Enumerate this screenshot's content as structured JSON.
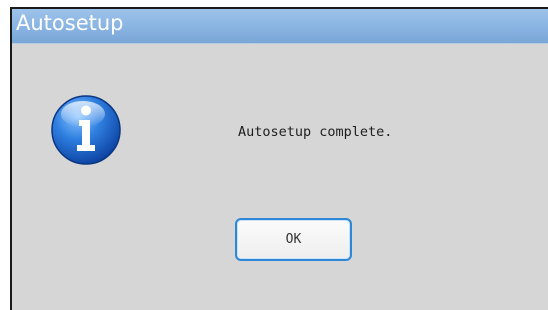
{
  "window": {
    "title": "Autosetup"
  },
  "dialog": {
    "icon": "info-icon",
    "message": "Autosetup complete.",
    "ok_label": "OK"
  },
  "colors": {
    "titlebar": "#8cb6e3",
    "title_text": "#ffffff",
    "dialog_background": "#d6d6d6",
    "button_focus_border": "#2e86d6",
    "info_icon": "#1a63c9"
  }
}
